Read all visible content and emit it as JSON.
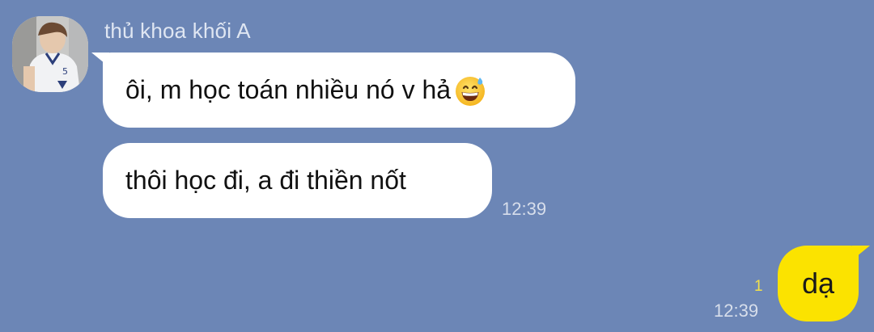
{
  "incoming": {
    "sender_name": "thủ khoa khối A",
    "messages": [
      {
        "text": "ôi, m học toán nhiều nó v hả",
        "emoji": "grinning-sweat-emoji"
      },
      {
        "text": "thôi học đi, a đi thiền nốt"
      }
    ],
    "time": "12:39"
  },
  "outgoing": {
    "text": "dạ",
    "unread_count": "1",
    "time": "12:39"
  },
  "colors": {
    "background": "#6c86b6",
    "incoming_bubble": "#ffffff",
    "outgoing_bubble": "#fbe300",
    "unread_count": "#f3e14a"
  }
}
